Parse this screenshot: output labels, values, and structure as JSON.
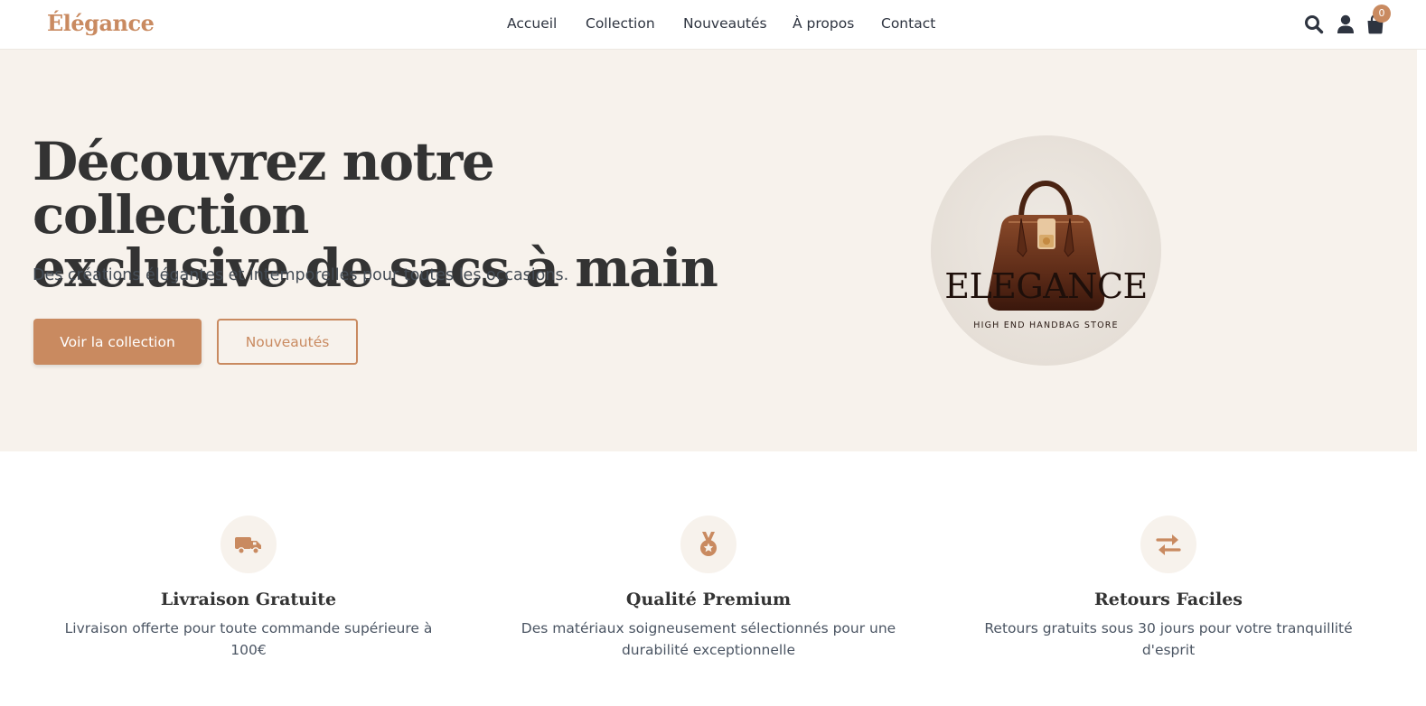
{
  "header": {
    "logo": "Élégance",
    "nav": [
      "Accueil",
      "Collection",
      "Nouveautés",
      "À propos",
      "Contact"
    ],
    "icons": [
      "search-icon",
      "user-icon",
      "cart-icon"
    ],
    "cart_count": "0"
  },
  "hero": {
    "title_line1": "Découvrez notre collection",
    "title_line2": "exclusive de sacs à main",
    "subtitle": "Des créations élégantes et intemporelles pour toutes les occasions.",
    "primary_button": "Voir la collection",
    "secondary_button": "Nouveautés",
    "brand_name": "ELEGANCE",
    "brand_tagline": "HIGH END HANDBAG STORE"
  },
  "features": [
    {
      "icon": "truck-icon",
      "title": "Livraison Gratuite",
      "description": "Livraison offerte pour toute commande supérieure à 100€"
    },
    {
      "icon": "medal-icon",
      "title": "Qualité Premium",
      "description": "Des matériaux soigneusement sélectionnés pour une durabilité exceptionnelle"
    },
    {
      "icon": "exchange-icon",
      "title": "Retours Faciles",
      "description": "Retours gratuits sous 30 jours pour votre tranquillité d'esprit"
    }
  ],
  "colors": {
    "accent": "#c98a60",
    "hero_background": "#f7f2ec",
    "text_dark": "#333333"
  }
}
